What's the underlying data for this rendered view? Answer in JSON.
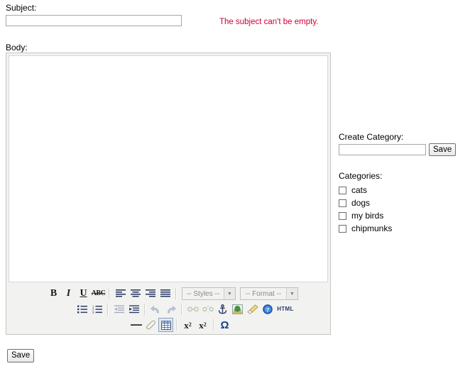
{
  "form": {
    "subject_label": "Subject:",
    "subject_value": "",
    "subject_error": "The subject can't be empty.",
    "body_label": "Body:",
    "body_value": "",
    "save_label": "Save"
  },
  "editor": {
    "styles_select": "-- Styles --",
    "format_select": "-- Format --",
    "html_button": "HTML",
    "toolbar_rows": [
      [
        {
          "name": "bold-button",
          "title": "Bold"
        },
        {
          "name": "italic-button",
          "title": "Italic"
        },
        {
          "name": "underline-button",
          "title": "Underline"
        },
        {
          "name": "strikethrough-button",
          "title": "Strike Through"
        },
        {
          "name": "align-left-button",
          "title": "Align Left"
        },
        {
          "name": "align-center-button",
          "title": "Center"
        },
        {
          "name": "align-right-button",
          "title": "Align Right"
        },
        {
          "name": "justify-button",
          "title": "Justify"
        },
        {
          "name": "styles-select",
          "title": "-- Styles --"
        },
        {
          "name": "format-select",
          "title": "-- Format --"
        }
      ],
      [
        {
          "name": "bulleted-list-button",
          "title": "Insert/Remove Bulleted List"
        },
        {
          "name": "numbered-list-button",
          "title": "Insert/Remove Numbered List"
        },
        {
          "name": "outdent-button",
          "title": "Decrease Indent"
        },
        {
          "name": "indent-button",
          "title": "Increase Indent"
        },
        {
          "name": "undo-button",
          "title": "Undo"
        },
        {
          "name": "redo-button",
          "title": "Redo"
        },
        {
          "name": "link-button",
          "title": "Link"
        },
        {
          "name": "unlink-button",
          "title": "Unlink"
        },
        {
          "name": "anchor-button",
          "title": "Anchor"
        },
        {
          "name": "image-button",
          "title": "Image"
        },
        {
          "name": "remove-format-button",
          "title": "Remove Format"
        },
        {
          "name": "about-button",
          "title": "About"
        },
        {
          "name": "html-source-button",
          "title": "HTML"
        }
      ],
      [
        {
          "name": "horizontal-rule-button",
          "title": "Insert Horizontal Line"
        },
        {
          "name": "eraser-button",
          "title": "Erase"
        },
        {
          "name": "table-button",
          "title": "Insert Table"
        },
        {
          "name": "subscript-button",
          "title": "Subscript"
        },
        {
          "name": "superscript-button",
          "title": "Superscript"
        },
        {
          "name": "special-character-button",
          "title": "Insert Special Character"
        }
      ]
    ]
  },
  "sidebar": {
    "create_category_label": "Create Category:",
    "create_category_value": "",
    "create_category_save_label": "Save",
    "categories_label": "Categories:",
    "categories": [
      {
        "label": "cats",
        "checked": false
      },
      {
        "label": "dogs",
        "checked": false
      },
      {
        "label": "my birds",
        "checked": false
      },
      {
        "label": "chipmunks",
        "checked": false
      }
    ]
  },
  "colors": {
    "error_text": "#cc0033",
    "toolbar_bg": "#f2f2f0",
    "editor_border": "#c6c6c6",
    "accent_blue": "#1c3f94"
  }
}
